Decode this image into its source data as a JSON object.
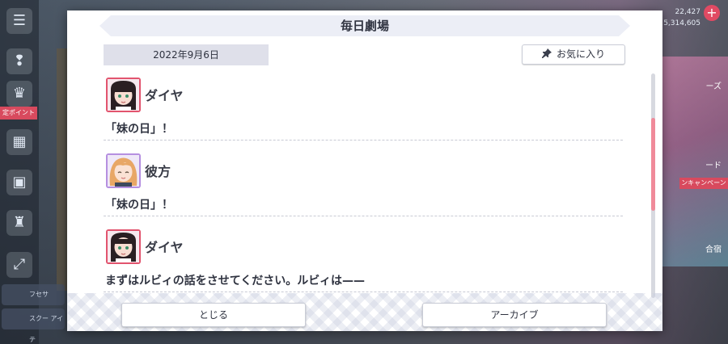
{
  "background": {
    "left_rail_tag": "定ポイント",
    "left_rail_small_1": "フセサ",
    "left_rail_small_2": "スクー アイテ",
    "right_stat_1": "22,427",
    "right_stat_2": "5,314,605",
    "right_label_1": "ーズ",
    "right_label_2": "ード",
    "right_label_3": "合宿",
    "right_red_tag": "ンキャンペーン",
    "accent_color": "#e14a63"
  },
  "modal": {
    "title": "毎日劇場",
    "date": "2022年9月6日",
    "favorite_label": "お気に入り",
    "messages": [
      {
        "speaker": "ダイヤ",
        "avatar": "dia-avatar",
        "text": "「妹の日」！"
      },
      {
        "speaker": "彼方",
        "avatar": "kanata-avatar",
        "text": "「妹の日」！"
      },
      {
        "speaker": "ダイヤ",
        "avatar": "dia-avatar",
        "text": "まずはルビィの話をさせてください。ルビィは——"
      }
    ],
    "close_label": "とじる",
    "archive_label": "アーカイブ",
    "scroll_thumb_color": "#f08a9a"
  }
}
